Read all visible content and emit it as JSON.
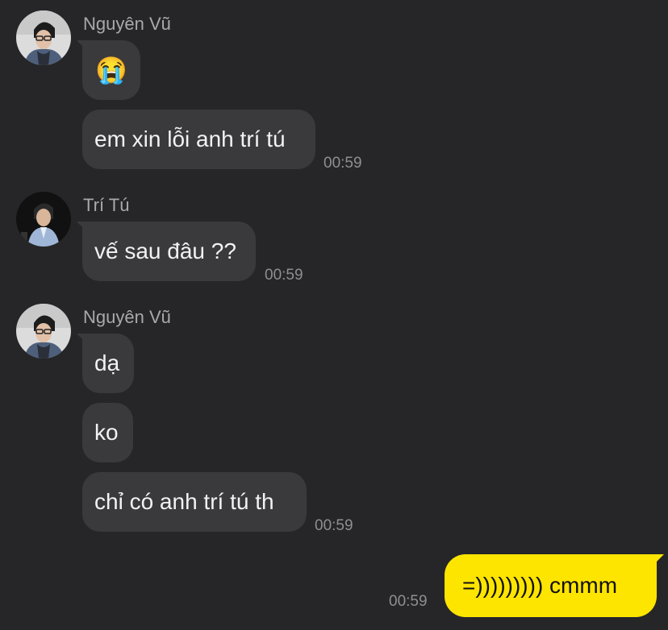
{
  "messages_group_1": {
    "sender": "Nguyên Vũ",
    "emoji": "😭",
    "text2": "em xin lỗi anh trí tú",
    "time": "00:59"
  },
  "messages_group_2": {
    "sender": "Trí Tú",
    "text1": "vế sau đâu ??",
    "time": "00:59"
  },
  "messages_group_3": {
    "sender": "Nguyên Vũ",
    "text1": "dạ",
    "text2": "ko",
    "text3": "chỉ có anh trí tú th",
    "time": "00:59"
  },
  "my_message": {
    "text": "=))))))))) cmmm",
    "time": "00:59"
  },
  "colors": {
    "background": "#262628",
    "incoming_bubble": "#3a3a3c",
    "outgoing_bubble": "#fee500",
    "timestamp": "#8e8e93",
    "sender_name": "#a9a9ac"
  }
}
